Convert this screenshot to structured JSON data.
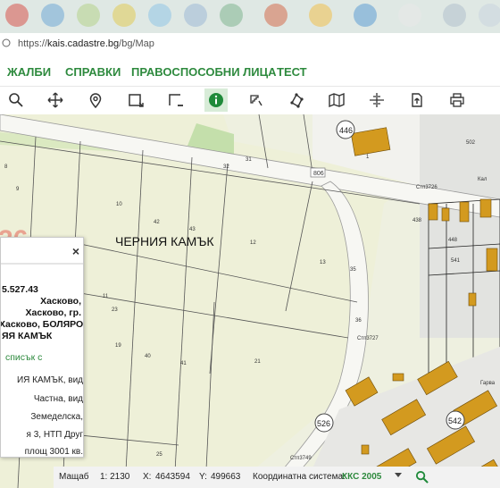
{
  "browser": {
    "url_prefix": "https://",
    "url_domain": "kais.cadastre.bg",
    "url_path": "/bg/Map"
  },
  "menu": {
    "items": [
      "ЖАЛБИ",
      "СПРАВКИ",
      "ПРАВОСПОСОБНИ ЛИЦА",
      "ТЕСТ"
    ]
  },
  "toolbar": {
    "tools": [
      "zoom-icon",
      "pan-icon",
      "location-pin-icon",
      "select-rect-icon",
      "deselect-icon",
      "info-icon",
      "measure-icon",
      "polygon-icon",
      "map-layers-icon",
      "crosshair-icon",
      "export-icon",
      "print-icon"
    ]
  },
  "map": {
    "locality_label": "ЧЕРНИЯ КАМЪК",
    "big_number": "36",
    "road_label": "806",
    "plot_numbers": [
      "9",
      "8",
      "10",
      "31",
      "32",
      "42",
      "43",
      "12",
      "13",
      "11",
      "23",
      "35",
      "36",
      "19",
      "40",
      "41",
      "21",
      "25",
      "502",
      "438",
      "448",
      "446",
      "526",
      "542",
      "541",
      "1"
    ],
    "bearing_labels": [
      "Стп3726",
      "Стп3727",
      "Стп3749"
    ],
    "street_labels": [
      "Кал",
      "Гарва"
    ]
  },
  "info_panel": {
    "close_label": "×",
    "identifier": "5.527.43",
    "address_lines": [
      "Хасково,",
      "Хасково, гр.",
      "Хасково, БОЛЯРОВО,",
      "ЯЯ КАМЪК"
    ],
    "link_text": "списък с",
    "description_lines": [
      "ИЯ КАМЪК, вид",
      "Частна, вид",
      "Земеделска,",
      "я 3, НТП Друг",
      "площ 3001 кв."
    ]
  },
  "status_bar": {
    "scale_label": "Мащаб",
    "scale_value": "1: 2130",
    "x_label": "X:",
    "x_value": "4643594",
    "y_label": "Y:",
    "y_value": "499663",
    "coord_label": "Координатна система:",
    "coord_system": "ККС 2005"
  },
  "colors": {
    "menu_green": "#2e8a3e",
    "map_background": "#eef0e0",
    "building": "#d39a1f",
    "road": "#f4f4f0"
  }
}
